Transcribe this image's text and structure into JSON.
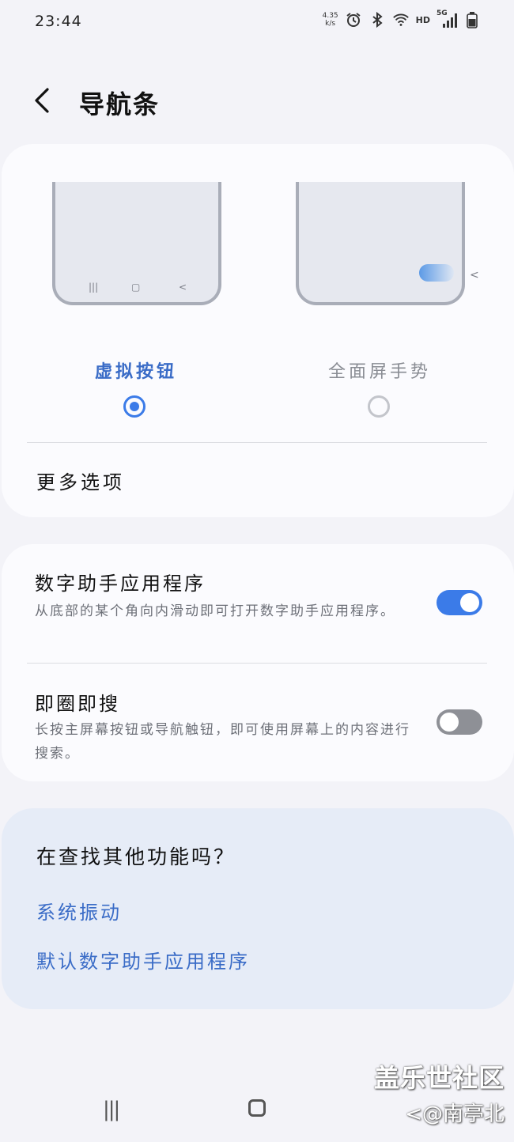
{
  "status": {
    "time": "23:44",
    "net_speed_value": "4.35",
    "net_speed_unit": "k/s",
    "hd": "HD",
    "network": "5G",
    "icons": [
      "alarm-icon",
      "bluetooth-icon",
      "wifi-icon",
      "signal-icon",
      "battery-icon"
    ]
  },
  "header": {
    "title": "导航条"
  },
  "nav_types": {
    "options": [
      {
        "label": "虚拟按钮",
        "selected": true
      },
      {
        "label": "全面屏手势",
        "selected": false
      }
    ],
    "more_options": "更多选项"
  },
  "settings": [
    {
      "title": "数字助手应用程序",
      "desc": "从底部的某个角向内滑动即可打开数字助手应用程序。",
      "enabled": true
    },
    {
      "title": "即圈即搜",
      "desc": "长按主屏幕按钮或导航触钮，即可使用屏幕上的内容进行搜索。",
      "enabled": false
    }
  ],
  "suggestions": {
    "question": "在查找其他功能吗？",
    "links": [
      "系统振动",
      "默认数字助手应用程序"
    ]
  },
  "watermark": {
    "line1": "盖乐世社区",
    "line2": "@南亭北"
  },
  "colors": {
    "accent": "#3b7be8",
    "link": "#3a6cc7",
    "background": "#f3f3f8",
    "card": "#fbfbfe",
    "suggest_card": "#e6ecf7"
  }
}
